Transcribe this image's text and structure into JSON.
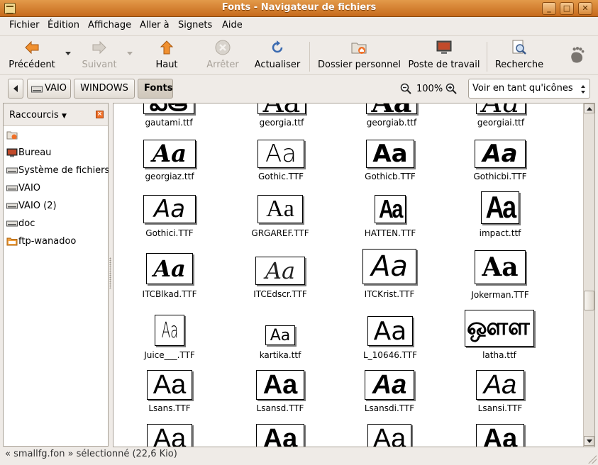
{
  "window": {
    "title": "Fonts - Navigateur de fichiers"
  },
  "menu": [
    "Fichier",
    "Édition",
    "Affichage",
    "Aller à",
    "Signets",
    "Aide"
  ],
  "toolbar": {
    "back": "Précédent",
    "forward": "Suivant",
    "up": "Haut",
    "stop": "Arrêter",
    "reload": "Actualiser",
    "home": "Dossier personnel",
    "desktop": "Poste de travail",
    "search": "Recherche"
  },
  "location": {
    "crumbs": [
      "VAIO",
      "WINDOWS",
      "Fonts"
    ],
    "zoom": "100%",
    "view_mode": "Voir en tant qu'icônes"
  },
  "sidebar": {
    "title": "Raccourcis",
    "items": [
      "Bureau",
      "Système de fichiers",
      "VAIO",
      "VAIO (2)",
      "doc",
      "ftp-wanadoo"
    ]
  },
  "files": [
    {
      "name": "gautami.ttf",
      "glyph": "ఎఆ"
    },
    {
      "name": "georgia.ttf",
      "glyph": "Aa"
    },
    {
      "name": "georgiab.ttf",
      "glyph": "Aa"
    },
    {
      "name": "georgiai.ttf",
      "glyph": "Aa"
    },
    {
      "name": "georgiaz.ttf",
      "glyph": "Aa"
    },
    {
      "name": "Gothic.TTF",
      "glyph": "Aa"
    },
    {
      "name": "Gothicb.TTF",
      "glyph": "Aa"
    },
    {
      "name": "Gothicbi.TTF",
      "glyph": "Aa"
    },
    {
      "name": "Gothici.TTF",
      "glyph": "Aa"
    },
    {
      "name": "GRGAREF.TTF",
      "glyph": "Aa"
    },
    {
      "name": "HATTEN.TTF",
      "glyph": "Aa"
    },
    {
      "name": "impact.ttf",
      "glyph": "Aa"
    },
    {
      "name": "ITCBlkad.TTF",
      "glyph": "Aa"
    },
    {
      "name": "ITCEdscr.TTF",
      "glyph": "Aa"
    },
    {
      "name": "ITCKrist.TTF",
      "glyph": "Aa"
    },
    {
      "name": "Jokerman.TTF",
      "glyph": "Aa"
    },
    {
      "name": "Juice___.TTF",
      "glyph": "Aa"
    },
    {
      "name": "kartika.ttf",
      "glyph": "Aa"
    },
    {
      "name": "L_10646.TTF",
      "glyph": "Aa"
    },
    {
      "name": "latha.ttf",
      "glyph": "ஔள"
    },
    {
      "name": "Lsans.TTF",
      "glyph": "Aa"
    },
    {
      "name": "Lsansd.TTF",
      "glyph": "Aa"
    },
    {
      "name": "Lsansdi.TTF",
      "glyph": "Aa"
    },
    {
      "name": "Lsansi.TTF",
      "glyph": "Aa"
    },
    {
      "name": "",
      "glyph": "Aa"
    },
    {
      "name": "",
      "glyph": "Aa"
    },
    {
      "name": "",
      "glyph": "Aa"
    },
    {
      "name": "",
      "glyph": "Aa"
    }
  ],
  "status": "« smallfg.fon » sélectionné (22,6 Kio)",
  "colors": {
    "titlebar": "#d07a2c",
    "accent": "#f07028"
  }
}
